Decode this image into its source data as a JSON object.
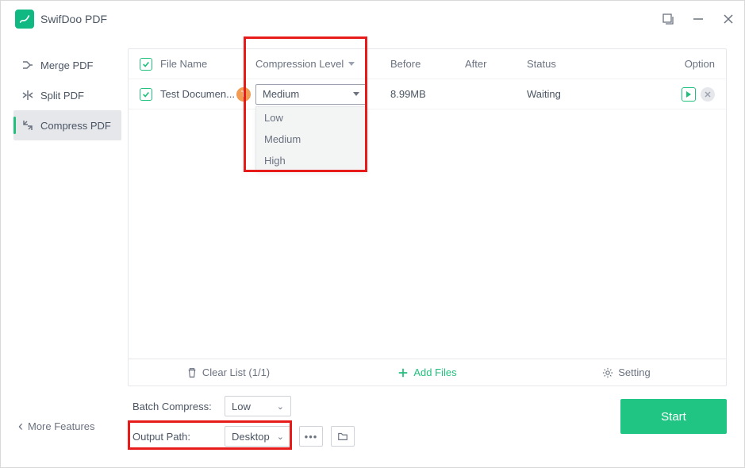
{
  "app_title": "SwifDoo PDF",
  "sidebar": {
    "items": [
      {
        "label": "Merge PDF"
      },
      {
        "label": "Split PDF"
      },
      {
        "label": "Compress PDF"
      }
    ]
  },
  "table": {
    "headers": {
      "filename": "File Name",
      "level": "Compression Level",
      "before": "Before",
      "after": "After",
      "status": "Status",
      "option": "Option"
    },
    "rows": [
      {
        "name": "Test Documen...",
        "badge": "T",
        "level": "Medium",
        "before": "8.99MB",
        "after": "",
        "status": "Waiting"
      }
    ],
    "dropdown_options": [
      "Low",
      "Medium",
      "High"
    ]
  },
  "actions": {
    "clear": "Clear List (1/1)",
    "add": "Add Files",
    "setting": "Setting"
  },
  "footer": {
    "more": "More Features",
    "batch_label": "Batch Compress:",
    "batch_value": "Low",
    "output_label": "Output Path:",
    "output_value": "Desktop",
    "start": "Start"
  }
}
